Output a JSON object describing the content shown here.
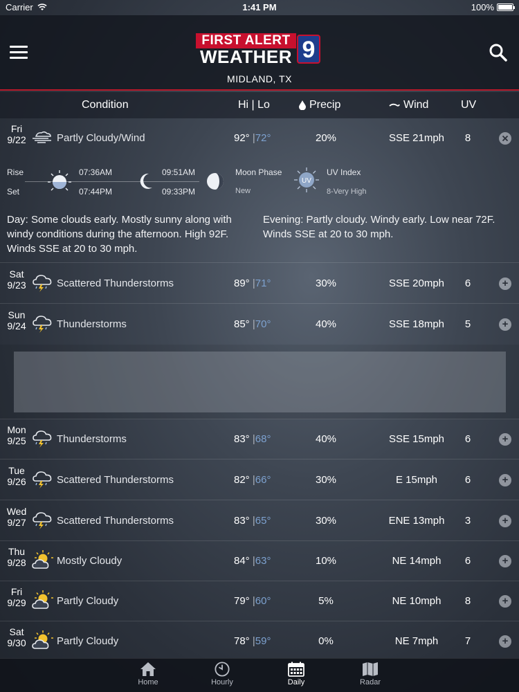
{
  "status_bar": {
    "carrier": "Carrier",
    "time": "1:41 PM",
    "battery": "100%"
  },
  "header": {
    "logo_top": "FIRST ALERT",
    "logo_bottom": "WEATHER",
    "logo_nine": "9",
    "location": "MIDLAND, TX"
  },
  "columns": {
    "condition": "Condition",
    "hilo": "Hi | Lo",
    "precip": "Precip",
    "wind": "Wind",
    "uv": "UV"
  },
  "expanded": {
    "day": "Fri",
    "date": "9/22",
    "condition": "Partly Cloudy/Wind",
    "hi": "92°",
    "lo": "72°",
    "precip": "20%",
    "wind": "SSE 21mph",
    "uv": "8",
    "rise_label": "Rise",
    "set_label": "Set",
    "sunrise": "07:36AM",
    "sunset": "07:44PM",
    "moonrise": "09:51AM",
    "moonset": "09:33PM",
    "moon_phase_label": "Moon Phase",
    "moon_phase": "New",
    "uv_index_label": "UV Index",
    "uv_index": "8-Very High",
    "uv_badge": "UV",
    "day_text": "Day: Some clouds early. Mostly sunny along with windy conditions during the afternoon. High 92F. Winds SSE at 20 to 30 mph.",
    "evening_text": "Evening: Partly cloudy. Windy early. Low near 72F. Winds SSE at 20 to 30 mph."
  },
  "rows": [
    {
      "day": "Sat",
      "date": "9/23",
      "icon": "thunder-icon",
      "condition": "Scattered Thunderstorms",
      "hi": "89°",
      "lo": "71°",
      "precip": "30%",
      "wind": "SSE 20mph",
      "uv": "6"
    },
    {
      "day": "Sun",
      "date": "9/24",
      "icon": "thunder-icon",
      "condition": "Thunderstorms",
      "hi": "85°",
      "lo": "70°",
      "precip": "40%",
      "wind": "SSE 18mph",
      "uv": "5"
    },
    {
      "day": "Mon",
      "date": "9/25",
      "icon": "thunder-icon",
      "condition": "Thunderstorms",
      "hi": "83°",
      "lo": "68°",
      "precip": "40%",
      "wind": "SSE 15mph",
      "uv": "6"
    },
    {
      "day": "Tue",
      "date": "9/26",
      "icon": "thunder-icon",
      "condition": "Scattered Thunderstorms",
      "hi": "82°",
      "lo": "66°",
      "precip": "30%",
      "wind": "E 15mph",
      "uv": "6"
    },
    {
      "day": "Wed",
      "date": "9/27",
      "icon": "thunder-icon",
      "condition": "Scattered Thunderstorms",
      "hi": "83°",
      "lo": "65°",
      "precip": "30%",
      "wind": "ENE 13mph",
      "uv": "3"
    },
    {
      "day": "Thu",
      "date": "9/28",
      "icon": "partly-sunny-icon",
      "condition": "Mostly Cloudy",
      "hi": "84°",
      "lo": "63°",
      "precip": "10%",
      "wind": "NE 14mph",
      "uv": "6"
    },
    {
      "day": "Fri",
      "date": "9/29",
      "icon": "partly-sunny-icon",
      "condition": "Partly Cloudy",
      "hi": "79°",
      "lo": "60°",
      "precip": "5%",
      "wind": "NE 10mph",
      "uv": "8"
    },
    {
      "day": "Sat",
      "date": "9/30",
      "icon": "partly-sunny-icon",
      "condition": "Partly Cloudy",
      "hi": "78°",
      "lo": "59°",
      "precip": "0%",
      "wind": "NE 7mph",
      "uv": "7"
    }
  ],
  "tabs": [
    {
      "label": "Home",
      "icon": "home-icon"
    },
    {
      "label": "Hourly",
      "icon": "clock-icon"
    },
    {
      "label": "Daily",
      "icon": "calendar-icon",
      "active": true
    },
    {
      "label": "Radar",
      "icon": "map-icon"
    }
  ]
}
